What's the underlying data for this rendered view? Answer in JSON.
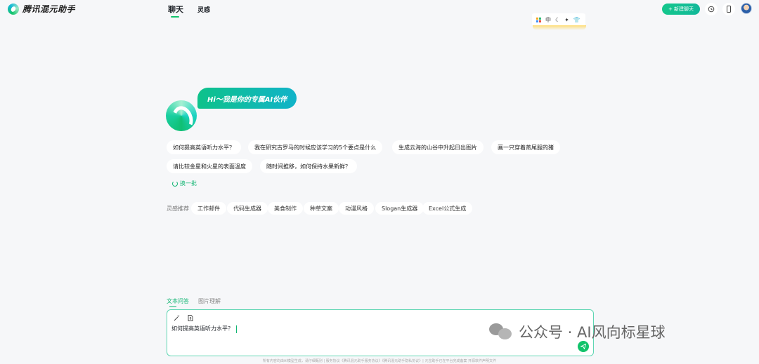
{
  "header": {
    "brand": "腾讯混元助手",
    "nav": [
      {
        "label": "聊天",
        "active": true
      },
      {
        "label": "灵感",
        "active": false
      }
    ],
    "new_chat": "+ 新建聊天",
    "icons": [
      "history-icon",
      "phone-icon"
    ]
  },
  "ime_bar": {
    "lang": "中",
    "icons": [
      "apps-icon",
      "moon-icon",
      "sparkle-icon",
      "shirt-icon"
    ]
  },
  "hero": {
    "greeting": "Hi～我是你的专属AI伙伴"
  },
  "suggestions": [
    "如何提高英语听力水平？",
    "我在研究古罗马的时候应该学习的5个要点是什么",
    "生成云海的山谷中升起日出图片",
    "画一只穿着燕尾服的猪",
    "请比较金星和火星的表面温度",
    "随时间推移，如何保持水果新鲜？"
  ],
  "refresh_label": "换一批",
  "inspiration": {
    "label": "灵感推荐",
    "items": [
      "工作邮件",
      "代码生成器",
      "美食制作",
      "种草文案",
      "动漫风格",
      "Slogan生成器",
      "Excel公式生成"
    ]
  },
  "modes": [
    {
      "label": "文本问答",
      "active": true
    },
    {
      "label": "图片理解",
      "active": false
    }
  ],
  "input": {
    "value": "如何提高英语听力水平？"
  },
  "footer": "所有内容均由AI模型生成，请仔细甄别 | 服务协议《腾讯混元助手服务协议》《腾讯混元助手隐私协议》| 元宝助手已在平台完成备案 开源软件声明文件",
  "watermark": "公众号 · AI风向标星球",
  "colors": {
    "accent": "#12c36b",
    "background": "#f6f7f9"
  }
}
